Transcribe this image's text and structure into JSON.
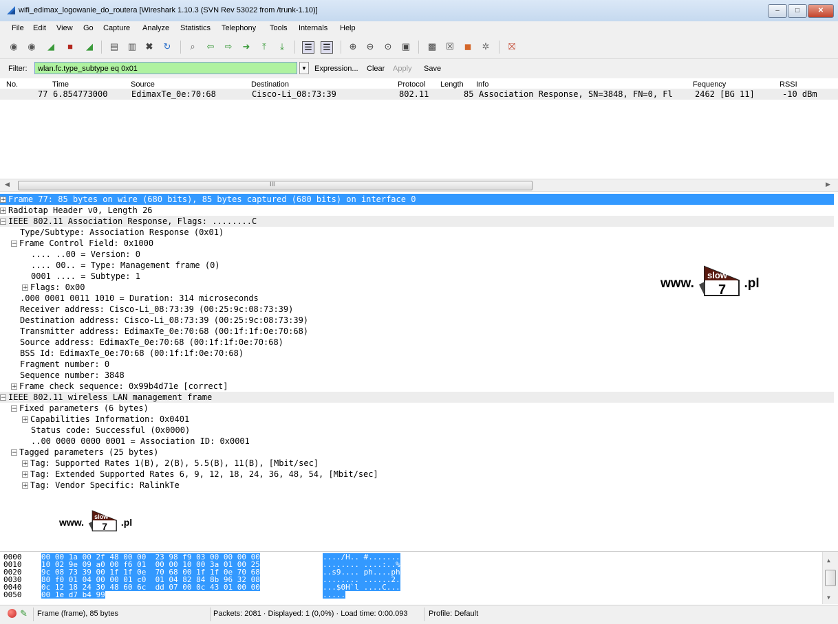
{
  "window": {
    "title": "wifi_edimax_logowanie_do_routera  [Wireshark 1.10.3  (SVN Rev 53022 from /trunk-1.10)]",
    "minimize": "–",
    "maximize": "□",
    "close": "✕"
  },
  "menu": [
    "File",
    "Edit",
    "View",
    "Go",
    "Capture",
    "Analyze",
    "Statistics",
    "Telephony",
    "Tools",
    "Internals",
    "Help"
  ],
  "toolbar_icons": [
    "capture-interfaces-icon",
    "capture-options-icon",
    "start-capture-icon",
    "stop-capture-icon",
    "restart-capture-icon",
    "open-file-icon",
    "save-file-icon",
    "close-file-icon",
    "reload-icon",
    "find-packet-icon",
    "go-back-icon",
    "go-forward-icon",
    "go-to-packet-icon",
    "go-first-icon",
    "go-last-icon",
    "colorize-icon",
    "autoscroll-icon",
    "zoom-in-icon",
    "zoom-out-icon",
    "zoom-normal-icon",
    "resize-columns-icon",
    "capture-filters-icon",
    "display-filters-icon",
    "coloring-rules-icon",
    "preferences-icon",
    "help-icon"
  ],
  "filter": {
    "label": "Filter:",
    "value": "wlan.fc.type_subtype eq 0x01",
    "expression": "Expression...",
    "clear": "Clear",
    "apply": "Apply",
    "save": "Save",
    "bg_color": "#aff2a0"
  },
  "packet_list": {
    "columns": [
      "No.",
      "Time",
      "Source",
      "Destination",
      "Protocol",
      "Length",
      "Info",
      "Fequency",
      "RSSI"
    ],
    "rows": [
      {
        "no": "77",
        "time": "6.854773000",
        "source": "EdimaxTe_0e:70:68",
        "destination": "Cisco-Li_08:73:39",
        "protocol": "802.11",
        "length": "85",
        "info": "Association Response, SN=3848, FN=0, Fl",
        "frequency": "2462 [BG 11]",
        "rssi": "-10 dBm"
      }
    ],
    "hscroll_label": "III"
  },
  "details": [
    {
      "toggle": "+",
      "text": "Frame 77: 85 bytes on wire (680 bits), 85 bytes captured (680 bits) on interface 0",
      "style": "selected"
    },
    {
      "toggle": "+",
      "text": "Radiotap Header v0, Length 26",
      "style": ""
    },
    {
      "toggle": "-",
      "text": "IEEE 802.11 Association Response, Flags: ........C",
      "style": "grey"
    },
    {
      "toggle": "",
      "text": "Type/Subtype: Association Response (0x01)",
      "style": ""
    },
    {
      "toggle": "-",
      "text": "Frame Control Field: 0x1000",
      "style": ""
    },
    {
      "toggle": "",
      "text": ".... ..00 = Version: 0",
      "style": ""
    },
    {
      "toggle": "",
      "text": ".... 00.. = Type: Management frame (0)",
      "style": ""
    },
    {
      "toggle": "",
      "text": "0001 .... = Subtype: 1",
      "style": ""
    },
    {
      "toggle": "+",
      "text": "Flags: 0x00",
      "style": ""
    },
    {
      "toggle": "",
      "text": ".000 0001 0011 1010 = Duration: 314 microseconds",
      "style": ""
    },
    {
      "toggle": "",
      "text": "Receiver address: Cisco-Li_08:73:39 (00:25:9c:08:73:39)",
      "style": ""
    },
    {
      "toggle": "",
      "text": "Destination address: Cisco-Li_08:73:39 (00:25:9c:08:73:39)",
      "style": ""
    },
    {
      "toggle": "",
      "text": "Transmitter address: EdimaxTe_0e:70:68 (00:1f:1f:0e:70:68)",
      "style": ""
    },
    {
      "toggle": "",
      "text": "Source address: EdimaxTe_0e:70:68 (00:1f:1f:0e:70:68)",
      "style": ""
    },
    {
      "toggle": "",
      "text": "BSS Id: EdimaxTe_0e:70:68 (00:1f:1f:0e:70:68)",
      "style": ""
    },
    {
      "toggle": "",
      "text": "Fragment number: 0",
      "style": ""
    },
    {
      "toggle": "",
      "text": "Sequence number: 3848",
      "style": ""
    },
    {
      "toggle": "+",
      "text": "Frame check sequence: 0x99b4d71e [correct]",
      "style": ""
    },
    {
      "toggle": "-",
      "text": "IEEE 802.11 wireless LAN management frame",
      "style": "grey"
    },
    {
      "toggle": "-",
      "text": "Fixed parameters (6 bytes)",
      "style": ""
    },
    {
      "toggle": "+",
      "text": "Capabilities Information: 0x0401",
      "style": ""
    },
    {
      "toggle": "",
      "text": "Status code: Successful (0x0000)",
      "style": ""
    },
    {
      "toggle": "",
      "text": "..00 0000 0000 0001 = Association ID: 0x0001",
      "style": ""
    },
    {
      "toggle": "-",
      "text": "Tagged parameters (25 bytes)",
      "style": ""
    },
    {
      "toggle": "+",
      "text": "Tag: Supported Rates 1(B), 2(B), 5.5(B), 11(B), [Mbit/sec]",
      "style": ""
    },
    {
      "toggle": "+",
      "text": "Tag: Extended Supported Rates 6, 9, 12, 18, 24, 36, 48, 54, [Mbit/sec]",
      "style": ""
    },
    {
      "toggle": "+",
      "text": "Tag: Vendor Specific: RalinkTe",
      "style": ""
    }
  ],
  "watermark": {
    "prefix": "www.",
    "flag": "slow",
    "number": "7",
    "suffix": ".pl"
  },
  "hex": [
    {
      "offset": "0000",
      "bytes": "00 00 1a 00 2f 48 00 00  23 98 f9 03 00 00 00 00",
      "ascii": "..../H.. #......."
    },
    {
      "offset": "0010",
      "bytes": "10 02 9e 09 a0 00 f6 01  00 00 10 00 3a 01 00 25",
      "ascii": "........ ....:..%"
    },
    {
      "offset": "0020",
      "bytes": "9c 08 73 39 00 1f 1f 0e  70 68 00 1f 1f 0e 70 68",
      "ascii": "..s9.... ph....ph"
    },
    {
      "offset": "0030",
      "bytes": "80 f0 01 04 00 00 01 c0  01 04 82 84 8b 96 32 08",
      "ascii": "........ ......2."
    },
    {
      "offset": "0040",
      "bytes": "0c 12 18 24 30 48 60 6c  dd 07 00 0c 43 01 00 00",
      "ascii": "...$0H`l ....C..."
    },
    {
      "offset": "0050",
      "bytes": "00 1e d7 b4 99",
      "ascii": "....."
    }
  ],
  "status": {
    "frame": "Frame (frame), 85 bytes",
    "packets": "Packets: 2081 · Displayed: 1 (0,0%) · Load time: 0:00.093",
    "profile": "Profile: Default"
  }
}
